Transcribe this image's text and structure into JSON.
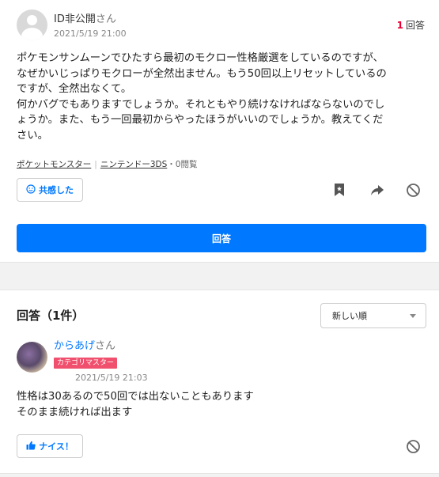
{
  "question": {
    "user_name": "ID非公開",
    "user_suffix": "さん",
    "date": "2021/5/19 21:00",
    "answer_count": "1",
    "answer_count_label": "回答",
    "body": "ポケモンサンムーンでひたすら最初のモクロー性格厳選をしているのですが、\nなぜかいじっぱりモクローが全然出ません。もう50回以上リセットしているの\nですが、全然出なくて。\n何かバグでもありますでしょうか。それともやり続けなければならないのでし\nょうか。また、もう一回最初からやったほうがいいのでしょうか。教えてくだ\nさい。",
    "categories": [
      "ポケットモンスター",
      "ニンテンドー3DS"
    ],
    "views": "・0閲覧",
    "kyokan_label": "共感した",
    "icons": [
      "bookmark-icon",
      "share-icon",
      "block-icon"
    ]
  },
  "answer_button_label": "回答",
  "answers": {
    "heading": "回答（1件）",
    "sort_selected": "新しい順",
    "items": [
      {
        "user_name": "からあげ",
        "user_suffix": "さん",
        "badge": "カテゴリマスター",
        "date": "2021/5/19 21:03",
        "body": "性格は30あるので50回では出ないこともあります\nそのまま続ければ出ます",
        "nice_label": "ナイス！"
      }
    ]
  },
  "colors": {
    "accent": "#0078ff",
    "count_red": "#e60033",
    "badge_pink": "#f0506e"
  }
}
